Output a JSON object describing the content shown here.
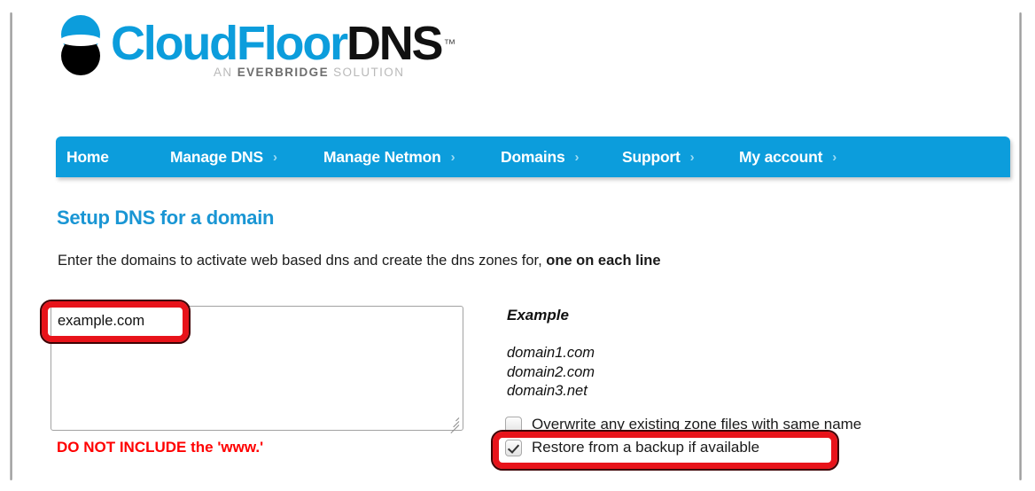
{
  "brand": {
    "logo_icon": "cloudfloordns-circles-logo",
    "name_part1": "CloudFloor",
    "name_part2": "DNS",
    "trademark": "™",
    "tagline_prefix": "AN ",
    "tagline_brand": "EVERBRIDGE",
    "tagline_suffix": " SOLUTION",
    "accent_color": "#0c9ddc",
    "dark_color": "#000000"
  },
  "nav": {
    "items": [
      {
        "label": "Home",
        "chevron": "",
        "name": "nav-item-home"
      },
      {
        "label": "Manage DNS",
        "chevron": "›",
        "name": "nav-item-manage-dns"
      },
      {
        "label": "Manage Netmon",
        "chevron": "›",
        "name": "nav-item-manage-netmon"
      },
      {
        "label": "Domains",
        "chevron": "›",
        "name": "nav-item-domains"
      },
      {
        "label": "Support",
        "chevron": "›",
        "name": "nav-item-support"
      },
      {
        "label": "My account",
        "chevron": "›",
        "name": "nav-item-my-account"
      }
    ]
  },
  "main": {
    "title": "Setup DNS for a domain",
    "intro_text": "Enter the domains to activate web based dns and create the dns zones for, ",
    "intro_bold": "one on each line",
    "textarea": {
      "value": "example.com",
      "placeholder": ""
    },
    "warning": "DO NOT INCLUDE the 'www.'",
    "warning_color": "#ff0000",
    "example": {
      "heading": "Example",
      "lines": [
        "domain1.com",
        "domain2.com",
        "domain3.net"
      ]
    },
    "checkboxes": [
      {
        "label": "Overwrite any existing zone files with same name",
        "checked": false,
        "name": "checkbox-overwrite-existing-zone-files"
      },
      {
        "label": "Restore from a backup if available",
        "checked": true,
        "name": "checkbox-restore-from-backup"
      }
    ]
  },
  "annotations": {
    "highlight_color": "#e8131a",
    "boxes": [
      {
        "target": "domains-textarea-first-line"
      },
      {
        "target": "checkbox-restore-from-backup-row"
      }
    ]
  }
}
